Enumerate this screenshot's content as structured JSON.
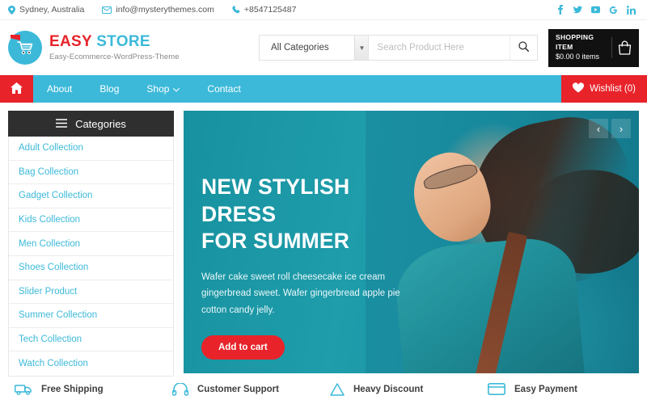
{
  "topbar": {
    "location": "Sydney, Australia",
    "email": "info@mysterythemes.com",
    "phone": "+8547125487",
    "socials": [
      {
        "name": "facebook-icon",
        "label": "f"
      },
      {
        "name": "twitter-icon",
        "label": "t"
      },
      {
        "name": "youtube-icon",
        "label": "yt"
      },
      {
        "name": "google-plus-icon",
        "label": "G"
      },
      {
        "name": "linkedin-icon",
        "label": "in"
      }
    ]
  },
  "header": {
    "brand_first": "EASY",
    "brand_second": "STORE",
    "tagline": "Easy-Ecommerce-WordPress-Theme",
    "search": {
      "category_selected": "All Categories",
      "placeholder": "Search Product Here",
      "value": ""
    },
    "cart": {
      "title": "SHOPPING ITEM",
      "summary": "$0.00 0 items"
    }
  },
  "nav": {
    "home_label": "Home",
    "items": [
      {
        "label": "About",
        "has_dropdown": false
      },
      {
        "label": "Blog",
        "has_dropdown": false
      },
      {
        "label": "Shop",
        "has_dropdown": true
      },
      {
        "label": "Contact",
        "has_dropdown": false
      }
    ],
    "wishlist_label": "Wishlist (0)"
  },
  "sidebar": {
    "heading": "Categories",
    "items": [
      {
        "label": "Adult Collection"
      },
      {
        "label": "Bag Collection"
      },
      {
        "label": "Gadget Collection"
      },
      {
        "label": "Kids Collection"
      },
      {
        "label": "Men Collection"
      },
      {
        "label": "Shoes Collection"
      },
      {
        "label": "Slider Product"
      },
      {
        "label": "Summer Collection"
      },
      {
        "label": "Tech Collection"
      },
      {
        "label": "Watch Collection"
      }
    ]
  },
  "hero": {
    "title_line1": "NEW STYLISH DRESS",
    "title_line2": "FOR SUMMER",
    "description": "Wafer cake sweet roll cheesecake ice cream gingerbread sweet. Wafer gingerbread apple pie cotton candy jelly.",
    "button_label": "Add to cart",
    "prev_label": "‹",
    "next_label": "›"
  },
  "features": [
    {
      "title": "Free Shipping",
      "icon": "truck-icon"
    },
    {
      "title": "Customer Support",
      "icon": "headset-icon"
    },
    {
      "title": "Heavy Discount",
      "icon": "tag-icon"
    },
    {
      "title": "Easy Payment",
      "icon": "credit-card-icon"
    }
  ],
  "colors": {
    "primary_cyan": "#3cb9d9",
    "accent_red": "#e8232a",
    "dark": "#2f2f2f",
    "hero_teal": "#1f9dab"
  }
}
